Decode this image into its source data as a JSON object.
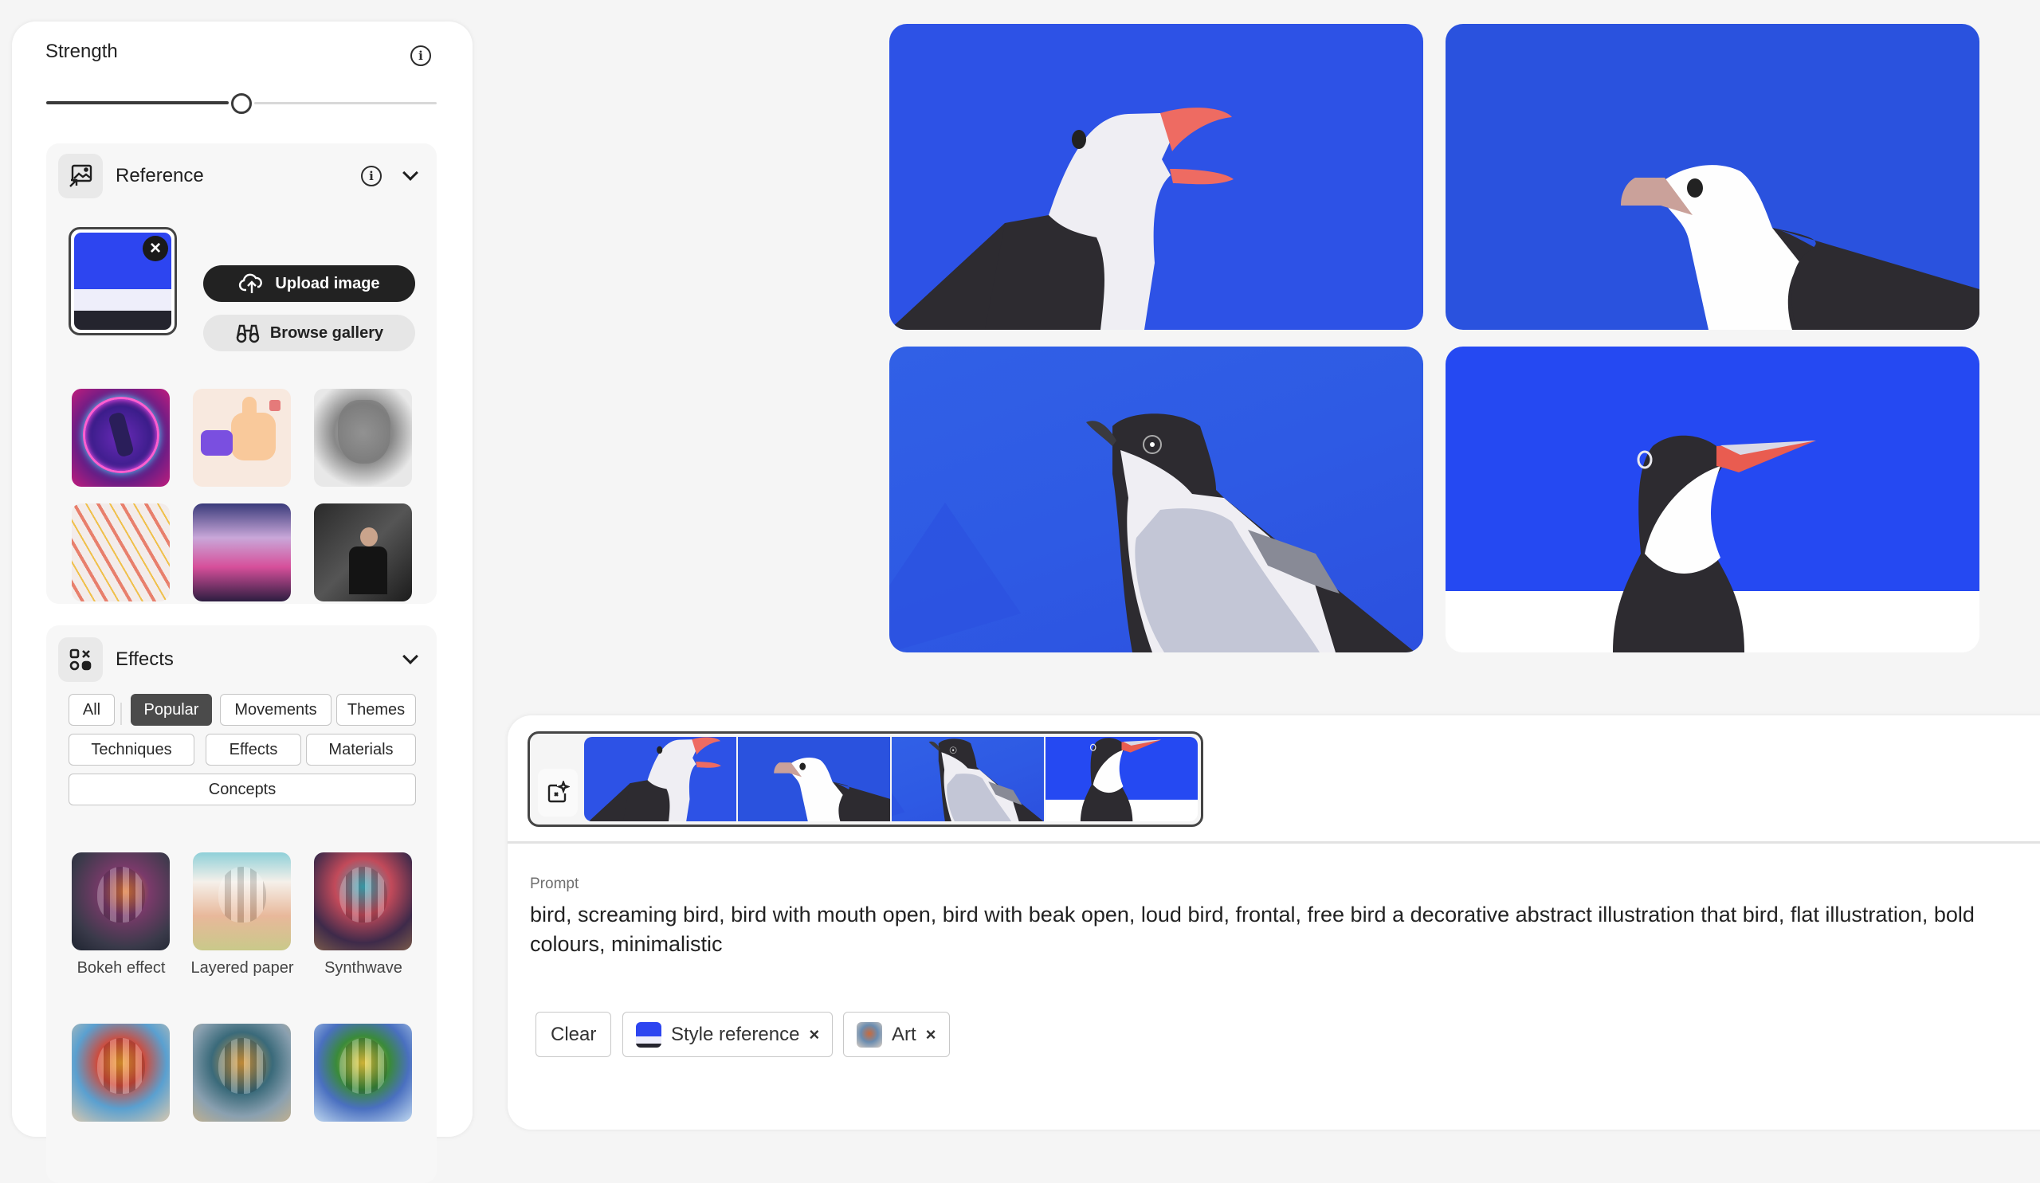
{
  "sidebar": {
    "strength": {
      "label": "Strength",
      "value": 0.5,
      "info_icon": "info-icon"
    },
    "reference": {
      "title": "Reference",
      "icon": "image-reference-icon",
      "info_icon": "info-icon",
      "chevron": "chevron-down-icon",
      "selected_image": "blue-white-dark-stripes",
      "remove_icon": "close-icon",
      "upload_label": "Upload image",
      "upload_icon": "cloud-upload-icon",
      "browse_label": "Browse gallery",
      "browse_icon": "binoculars-icon",
      "gallery": [
        {
          "name": "neon-ring-figure"
        },
        {
          "name": "thumbs-up-3d"
        },
        {
          "name": "engraved-portrait"
        },
        {
          "name": "hands-pattern"
        },
        {
          "name": "pink-clouds"
        },
        {
          "name": "man-in-suit"
        }
      ]
    },
    "effects": {
      "title": "Effects",
      "icon": "effects-grid-icon",
      "chevron": "chevron-down-icon",
      "filters": [
        {
          "label": "All",
          "active": false
        },
        {
          "label": "Popular",
          "active": true
        },
        {
          "label": "Movements",
          "active": false
        },
        {
          "label": "Themes",
          "active": false
        },
        {
          "label": "Techniques",
          "active": false
        },
        {
          "label": "Effects",
          "active": false
        },
        {
          "label": "Materials",
          "active": false
        },
        {
          "label": "Concepts",
          "active": false
        }
      ],
      "items": [
        {
          "label": "Bokeh effect"
        },
        {
          "label": "Layered paper"
        },
        {
          "label": "Synthwave"
        },
        {
          "label": ""
        },
        {
          "label": ""
        },
        {
          "label": ""
        }
      ]
    }
  },
  "gallery": {
    "images": [
      {
        "name": "screaming-gull"
      },
      {
        "name": "gull-profile"
      },
      {
        "name": "chickadee"
      },
      {
        "name": "tern"
      }
    ]
  },
  "prompt_panel": {
    "strip_icon": "generate-image-icon",
    "prompt_label": "Prompt",
    "prompt_text": "bird, screaming bird, bird with mouth open, bird with beak open, loud bird, frontal, free bird a decorative abstract illustration that bird, flat illustration, bold colours, minimalistic",
    "clear_label": "Clear",
    "tags": [
      {
        "label": "Style reference",
        "remove": "×"
      },
      {
        "label": "Art",
        "remove": "×"
      }
    ]
  },
  "colors": {
    "bird_blue": "#2d52e6",
    "bird_dark": "#2d2b30",
    "beak_coral": "#ee6b62",
    "active_chip": "#4b4b4b"
  }
}
